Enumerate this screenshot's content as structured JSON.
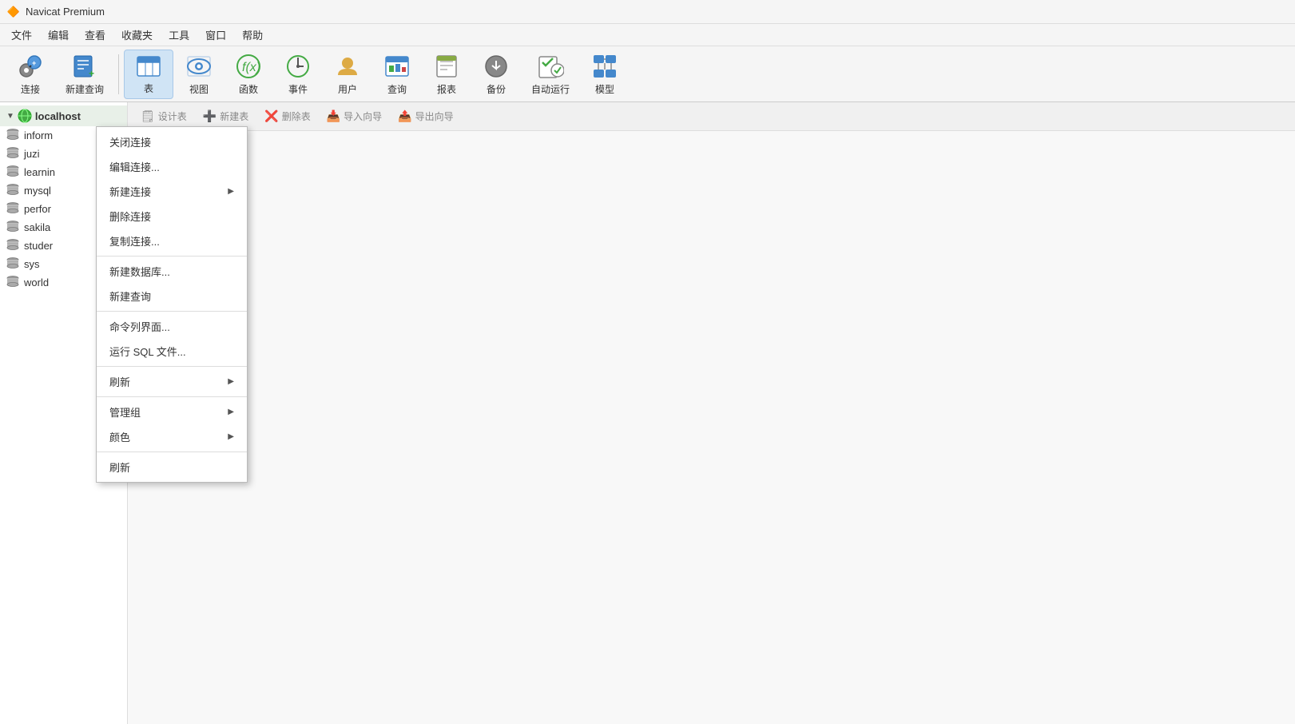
{
  "titleBar": {
    "title": "Navicat Premium",
    "icon": "🔶"
  },
  "menuBar": {
    "items": [
      "文件",
      "编辑",
      "查看",
      "收藏夹",
      "工具",
      "窗口",
      "帮助"
    ]
  },
  "toolbar": {
    "buttons": [
      {
        "id": "connect",
        "label": "连接",
        "icon": "🔌",
        "active": false,
        "hasDrop": true
      },
      {
        "id": "new-query",
        "label": "新建查询",
        "icon": "📋",
        "active": false,
        "hasDrop": true
      },
      {
        "id": "table",
        "label": "表",
        "icon": "🗒",
        "active": true,
        "hasDrop": false
      },
      {
        "id": "view",
        "label": "视图",
        "icon": "👓",
        "active": false,
        "hasDrop": false
      },
      {
        "id": "function",
        "label": "函数",
        "icon": "𝑓",
        "active": false,
        "hasDrop": false
      },
      {
        "id": "event",
        "label": "事件",
        "icon": "🕐",
        "active": false,
        "hasDrop": false
      },
      {
        "id": "user",
        "label": "用户",
        "icon": "👤",
        "active": false,
        "hasDrop": false
      },
      {
        "id": "query",
        "label": "查询",
        "icon": "📊",
        "active": false,
        "hasDrop": false
      },
      {
        "id": "report",
        "label": "报表",
        "icon": "📈",
        "active": false,
        "hasDrop": false
      },
      {
        "id": "backup",
        "label": "备份",
        "icon": "↩",
        "active": false,
        "hasDrop": false
      },
      {
        "id": "autorun",
        "label": "自动运行",
        "icon": "✅",
        "active": false,
        "hasDrop": false
      },
      {
        "id": "model",
        "label": "模型",
        "icon": "🗂",
        "active": false,
        "hasDrop": false
      }
    ]
  },
  "sidebar": {
    "connection": {
      "label": "localhost",
      "expanded": true
    },
    "databases": [
      {
        "name": "inform",
        "truncated": true
      },
      {
        "name": "juzi",
        "truncated": false
      },
      {
        "name": "learnin",
        "truncated": true
      },
      {
        "name": "mysql",
        "truncated": false
      },
      {
        "name": "perfor",
        "truncated": true
      },
      {
        "name": "sakila",
        "truncated": false
      },
      {
        "name": "studer",
        "truncated": true
      },
      {
        "name": "sys",
        "truncated": false
      },
      {
        "name": "world",
        "truncated": false
      }
    ]
  },
  "contentToolbar": {
    "buttons": [
      {
        "id": "design-table",
        "label": "设计表",
        "icon": "🗒"
      },
      {
        "id": "new-table",
        "label": "新建表",
        "icon": "➕"
      },
      {
        "id": "delete-table",
        "label": "删除表",
        "icon": "❌"
      },
      {
        "id": "import-wizard",
        "label": "导入向导",
        "icon": "📥"
      },
      {
        "id": "export-wizard",
        "label": "导出向导",
        "icon": "📤"
      }
    ]
  },
  "contextMenu": {
    "items": [
      {
        "id": "close-connection",
        "label": "关闭连接",
        "hasArrow": false,
        "isSeparator": false
      },
      {
        "id": "edit-connection",
        "label": "编辑连接...",
        "hasArrow": false,
        "isSeparator": false
      },
      {
        "id": "new-connection",
        "label": "新建连接",
        "hasArrow": true,
        "isSeparator": false
      },
      {
        "id": "delete-connection",
        "label": "删除连接",
        "hasArrow": false,
        "isSeparator": false
      },
      {
        "id": "copy-connection",
        "label": "复制连接...",
        "hasArrow": false,
        "isSeparator": false
      },
      {
        "id": "sep1",
        "label": "",
        "hasArrow": false,
        "isSeparator": true
      },
      {
        "id": "new-database",
        "label": "新建数据库...",
        "hasArrow": false,
        "isSeparator": false
      },
      {
        "id": "new-query2",
        "label": "新建查询",
        "hasArrow": false,
        "isSeparator": false
      },
      {
        "id": "sep2",
        "label": "",
        "hasArrow": false,
        "isSeparator": true
      },
      {
        "id": "command-line",
        "label": "命令列界面...",
        "hasArrow": false,
        "isSeparator": false
      },
      {
        "id": "run-sql",
        "label": "运行 SQL 文件...",
        "hasArrow": false,
        "isSeparator": false
      },
      {
        "id": "sep3",
        "label": "",
        "hasArrow": false,
        "isSeparator": true
      },
      {
        "id": "refresh",
        "label": "刷新",
        "hasArrow": true,
        "isSeparator": false
      },
      {
        "id": "sep4",
        "label": "",
        "hasArrow": false,
        "isSeparator": true
      },
      {
        "id": "manage-group",
        "label": "管理组",
        "hasArrow": true,
        "isSeparator": false
      },
      {
        "id": "color",
        "label": "颜色",
        "hasArrow": true,
        "isSeparator": false
      },
      {
        "id": "sep5",
        "label": "",
        "hasArrow": false,
        "isSeparator": true
      },
      {
        "id": "refresh2",
        "label": "刷新",
        "hasArrow": false,
        "isSeparator": false
      }
    ]
  }
}
